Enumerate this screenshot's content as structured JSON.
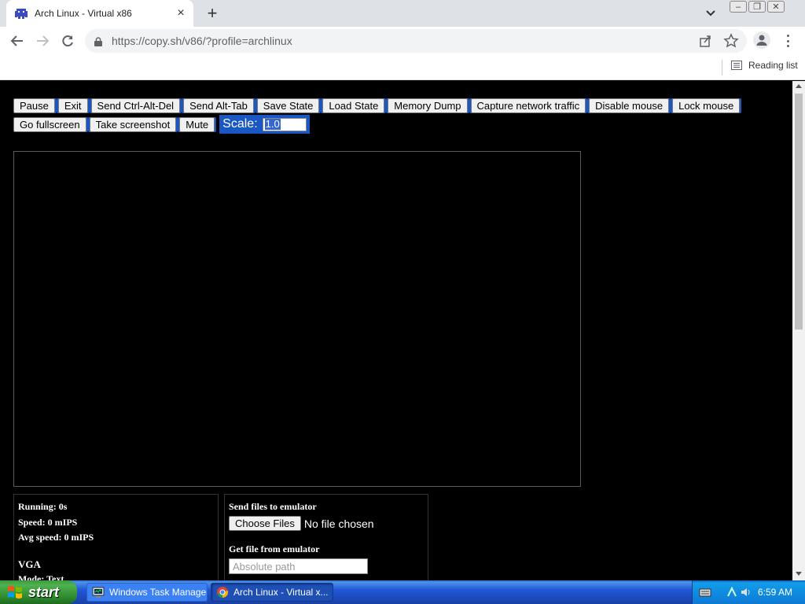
{
  "browser": {
    "tab_title": "Arch Linux - Virtual x86",
    "url": "https://copy.sh/v86/?profile=archlinux",
    "reading_list": "Reading list"
  },
  "controls": {
    "row1": [
      "Pause",
      "Exit",
      "Send Ctrl-Alt-Del",
      "Send Alt-Tab",
      "Save State",
      "Load State",
      "Memory Dump",
      "Capture network traffic",
      "Disable mouse",
      "Lock mouse"
    ],
    "row2": [
      "Go fullscreen",
      "Take screenshot",
      "Mute"
    ],
    "scale_label": "Scale:",
    "scale_value": "1.0"
  },
  "stats": {
    "running": "Running: 0s",
    "speed": "Speed: 0 mIPS",
    "avg_speed": "Avg speed: 0 mIPS",
    "vga_heading": "VGA",
    "mode_partial": "Mode: Text"
  },
  "files": {
    "send_label": "Send files to emulator",
    "choose_button": "Choose Files",
    "no_file": "No file chosen",
    "get_label": "Get file from emulator",
    "path_placeholder": "Absolute path"
  },
  "taskbar": {
    "start": "start",
    "items": [
      "Windows Task Manager",
      "Arch Linux - Virtual x..."
    ],
    "clock": "6:59 AM"
  },
  "colors": {
    "accent_blue": "#1a57c2",
    "start_green": "#3c9a3c",
    "taskbar_blue": "#2157d7"
  }
}
